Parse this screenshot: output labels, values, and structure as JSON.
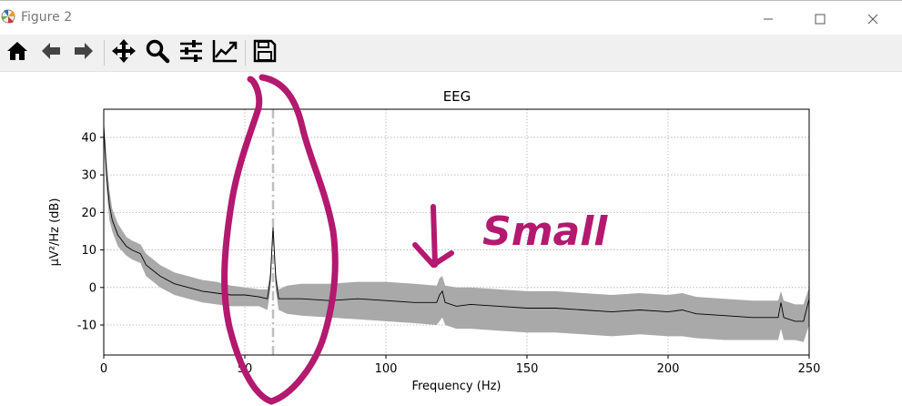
{
  "window": {
    "title": "Figure 2",
    "controls": [
      "minimize-icon",
      "maximize-icon",
      "close-icon"
    ]
  },
  "toolbar": {
    "buttons": [
      {
        "name": "home",
        "icon": "home-icon"
      },
      {
        "name": "back",
        "icon": "arrow-left-icon"
      },
      {
        "name": "forward",
        "icon": "arrow-right-icon"
      },
      {
        "name": "pan",
        "icon": "move-icon"
      },
      {
        "name": "zoom",
        "icon": "magnifier-icon"
      },
      {
        "name": "subplots",
        "icon": "sliders-icon"
      },
      {
        "name": "edit-axes",
        "icon": "line-chart-icon"
      },
      {
        "name": "save",
        "icon": "floppy-disk-icon"
      }
    ]
  },
  "annotation": {
    "text": "Small",
    "color": "#b3196e",
    "shapes": [
      "ellipse around 60 Hz peak",
      "down arrow"
    ]
  },
  "chart_data": {
    "type": "line",
    "title": "EEG",
    "xlabel": "Frequency (Hz)",
    "ylabel": "µV²/Hz (dB)",
    "xlim": [
      0,
      250
    ],
    "ylim": [
      -18,
      47.5
    ],
    "xticks": [
      0,
      50,
      100,
      150,
      200,
      250
    ],
    "yticks": [
      -10,
      0,
      10,
      20,
      30,
      40
    ],
    "grid": true,
    "line_color": "#000000",
    "band_color": "#a9a9a9",
    "marker_line": {
      "x": 60,
      "color": "#bfbfbf",
      "style": "dash-dot"
    },
    "series": [
      {
        "x": [
          0,
          1,
          2,
          3,
          5,
          8,
          10,
          13,
          15,
          20,
          25,
          30,
          35,
          40,
          45,
          50,
          55,
          58,
          59,
          60,
          61,
          62,
          65,
          70,
          80,
          90,
          100,
          110,
          118,
          119,
          120,
          121,
          125,
          130,
          140,
          150,
          160,
          170,
          180,
          190,
          200,
          205,
          210,
          220,
          230,
          239,
          240,
          241,
          245,
          248,
          250
        ],
        "values": [
          43,
          30,
          22,
          18,
          14,
          11,
          10,
          9,
          6,
          3,
          1,
          0,
          -1,
          -1.5,
          -2,
          -2,
          -2.5,
          -3,
          2,
          16,
          2,
          -3,
          -3,
          -3,
          -3.5,
          -3,
          -3.5,
          -4,
          -4,
          -2,
          -1,
          -4,
          -5,
          -4.5,
          -5,
          -5.5,
          -5.5,
          -6,
          -6.5,
          -6,
          -6.5,
          -6,
          -7,
          -7.5,
          -8,
          -8,
          -4,
          -8,
          -9,
          -9,
          -3
        ],
        "upper": [
          45,
          34,
          26,
          21,
          17,
          13.5,
          12.5,
          11.5,
          9,
          6,
          4,
          3,
          2,
          1.5,
          0.5,
          0,
          -0.5,
          -0.5,
          4,
          17,
          4,
          -0.5,
          0.5,
          1,
          1,
          1.5,
          1.5,
          1,
          0.5,
          2.5,
          3,
          0.5,
          0,
          0,
          -0.5,
          -1,
          -1,
          -1.5,
          -2,
          -1.5,
          -2,
          -1.5,
          -2.5,
          -3,
          -3.5,
          -3.5,
          -1,
          -3.5,
          -4.5,
          -4.5,
          0
        ],
        "lower": [
          40,
          26,
          18,
          15,
          11,
          8.5,
          7.5,
          6.5,
          3,
          0,
          -2,
          -3,
          -4,
          -4.5,
          -5,
          -5,
          -5,
          -6,
          -1,
          14,
          -1,
          -6,
          -7,
          -7.5,
          -8,
          -8.5,
          -9,
          -9.5,
          -10,
          -9,
          -8,
          -10,
          -11,
          -11,
          -11.5,
          -12,
          -12,
          -12.5,
          -13,
          -12.5,
          -13,
          -13,
          -13.5,
          -14,
          -14,
          -14,
          -11,
          -14,
          -14,
          -14.5,
          -10
        ]
      }
    ]
  }
}
